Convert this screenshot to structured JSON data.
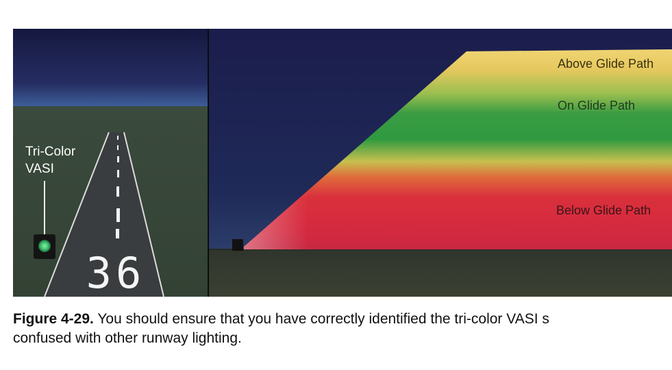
{
  "left_panel": {
    "label_line1": "Tri-Color",
    "label_line2": "VASI",
    "runway_number": "36"
  },
  "right_panel": {
    "label_above": "Above Glide Path",
    "label_on": "On Glide Path",
    "label_below": "Below Glide Path"
  },
  "caption": {
    "label": "Figure 4-29.",
    "line1": "You should ensure that you have correctly identified the tri-color VASI s",
    "line2": "confused with other runway lighting."
  },
  "colors": {
    "night_sky": "#1c1f4e",
    "ground": "#333b2e",
    "vasi_green": "#3fc06e",
    "above_band": "#e6c85f",
    "on_band": "#2f9a3f",
    "below_band": "#d62a3e"
  }
}
